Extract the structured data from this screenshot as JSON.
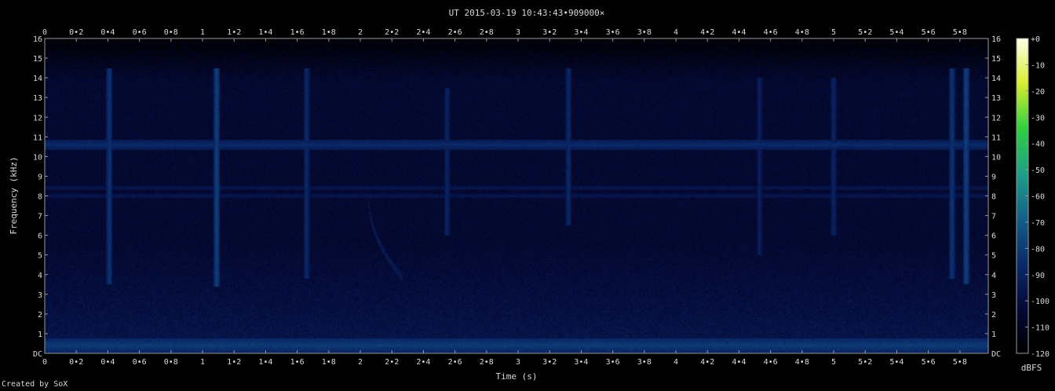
{
  "chart_data": {
    "type": "heatmap",
    "title": "UT 2015-03-19 10:43:43•909000×",
    "xlabel": "Time (s)",
    "ylabel": "Frequency (kHz)",
    "colorbar_label": "dBFS",
    "xlim": [
      0,
      5.98
    ],
    "ylim": [
      0,
      16
    ],
    "x_ticks": [
      "0",
      "0•2",
      "0•4",
      "0•6",
      "0•8",
      "1",
      "1•2",
      "1•4",
      "1•6",
      "1•8",
      "2",
      "2•2",
      "2•4",
      "2•6",
      "2•8",
      "3",
      "3•2",
      "3•4",
      "3•6",
      "3•8",
      "4",
      "4•2",
      "4•4",
      "4•6",
      "4•8",
      "5",
      "5•2",
      "5•4",
      "5•6",
      "5•8"
    ],
    "y_ticks": [
      "DC",
      "1",
      "2",
      "3",
      "4",
      "5",
      "6",
      "7",
      "8",
      "9",
      "10",
      "11",
      "12",
      "13",
      "14",
      "15",
      "16"
    ],
    "colorbar_ticks": [
      "+0",
      "-10",
      "-20",
      "-30",
      "-40",
      "-50",
      "-60",
      "-70",
      "-80",
      "-90",
      "-100",
      "-110",
      "-120"
    ],
    "colorbar_range": [
      -120,
      0
    ],
    "colormap": [
      "#000000",
      "#050a38",
      "#0a2a6a",
      "#14608a",
      "#1fa088",
      "#2fd040",
      "#d8ee30",
      "#ffffe8"
    ],
    "background_level_db": -105,
    "horizontal_bands": [
      {
        "freq_khz": 0.4,
        "width_khz": 0.35,
        "level_db": -80
      },
      {
        "freq_khz": 10.6,
        "width_khz": 0.25,
        "level_db": -86
      },
      {
        "freq_khz": 8.4,
        "width_khz": 0.12,
        "level_db": -95
      },
      {
        "freq_khz": 8.0,
        "width_khz": 0.12,
        "level_db": -95
      }
    ],
    "vertical_events": [
      {
        "time_s": 0.41,
        "f_low_khz": 3.5,
        "f_high_khz": 14.5,
        "level_db": -82
      },
      {
        "time_s": 1.09,
        "f_low_khz": 3.4,
        "f_high_khz": 14.5,
        "level_db": -78
      },
      {
        "time_s": 1.66,
        "f_low_khz": 3.8,
        "f_high_khz": 14.5,
        "level_db": -86
      },
      {
        "time_s": 2.55,
        "f_low_khz": 6.0,
        "f_high_khz": 13.5,
        "level_db": -88
      },
      {
        "time_s": 3.32,
        "f_low_khz": 6.5,
        "f_high_khz": 14.5,
        "level_db": -86
      },
      {
        "time_s": 4.53,
        "f_low_khz": 5.0,
        "f_high_khz": 14.0,
        "level_db": -90
      },
      {
        "time_s": 5.0,
        "f_low_khz": 6.0,
        "f_high_khz": 14.0,
        "level_db": -88
      },
      {
        "time_s": 5.75,
        "f_low_khz": 3.8,
        "f_high_khz": 14.5,
        "level_db": -82
      },
      {
        "time_s": 5.84,
        "f_low_khz": 3.5,
        "f_high_khz": 14.5,
        "level_db": -78
      }
    ],
    "sweep": {
      "t_start_s": 2.05,
      "f_start_khz": 8.0,
      "t_end_s": 2.27,
      "f_end_khz": 3.8,
      "level_db": -95
    }
  },
  "credit": "Created by SoX"
}
